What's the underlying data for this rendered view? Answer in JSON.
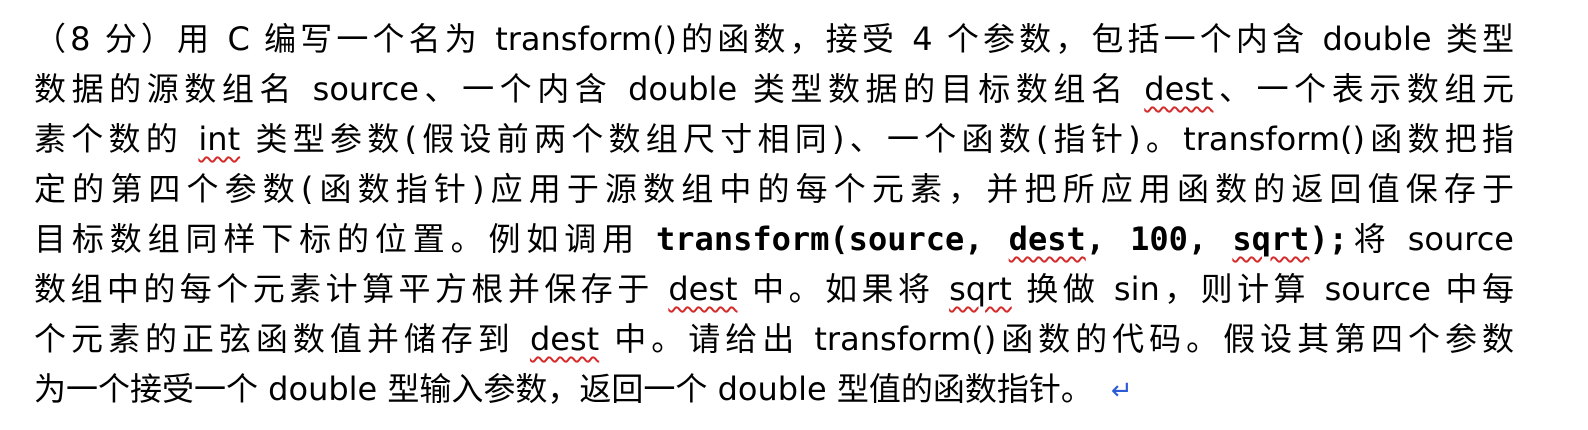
{
  "question": {
    "line1": "（8 分）用 C 编写一个名为 transform()的函数，接受 4 个参数，包括一个内含 double 类型",
    "line2_a": "数据的源数组名 source、一个内含 double 类型数据的目标数组名 ",
    "line2_b": "dest",
    "line2_c": "、一个表示数组元",
    "line3_a": "素个数的 ",
    "line3_b": "int",
    "line3_c": " 类型参数(假设前两个数组尺寸相同)、一个函数(指针)。transform()函数把指",
    "line4": "定的第四个参数(函数指针)应用于源数组中的每个元素，并把所应用函数的返回值保存于",
    "line5_a": "目标数组同样下标的位置。例如调用 ",
    "line5_code1": "transform(source, ",
    "line5_code2": "dest",
    "line5_code3": ", 100, ",
    "line5_code4": "sqrt",
    "line5_code5": ");",
    "line5_b": "将 source",
    "line6_a": "数组中的每个元素计算平方根并保存于 ",
    "line6_b": "dest",
    "line6_c": " 中。如果将 ",
    "line6_d": "sqrt",
    "line6_e": " 换做 sin，则计算 source 中每",
    "line7_a": "个元素的正弦函数值并储存到 ",
    "line7_b": "dest",
    "line7_c": " 中。请给出 transform()函数的代码。假设其第四个参数",
    "line8": "为一个接受一个 double 型输入参数，返回一个 double 型值的函数指针。",
    "paragraph_mark": "↵"
  }
}
